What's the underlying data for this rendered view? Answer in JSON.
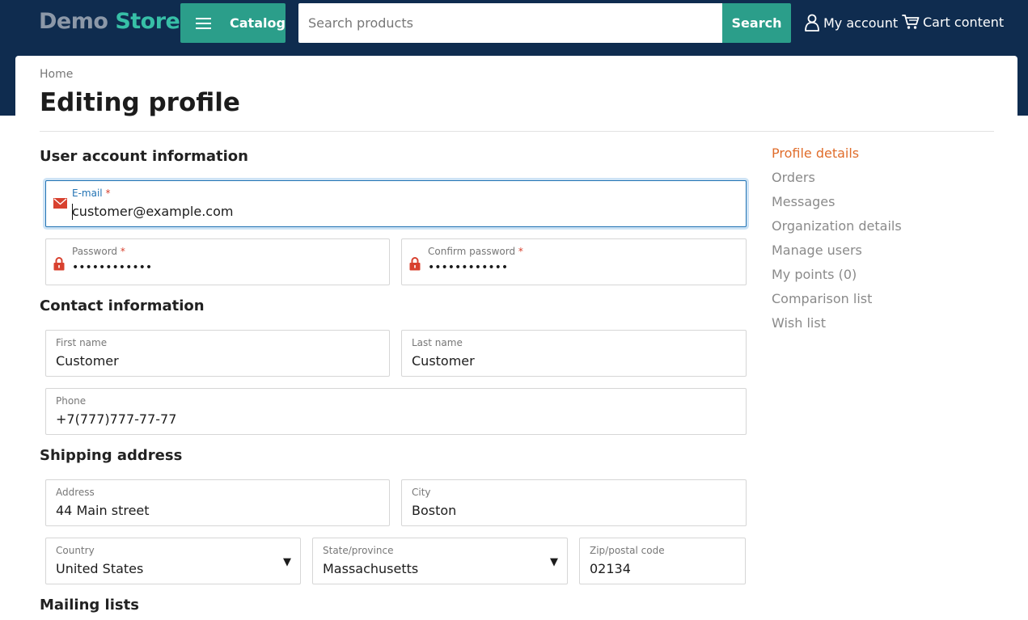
{
  "header": {
    "logo_part1": "Demo",
    "logo_part2": "Store",
    "catalog_label": "Catalog",
    "search_placeholder": "Search products",
    "search_button": "Search",
    "account_label": "My account",
    "cart_label": "Cart content"
  },
  "breadcrumb": "Home",
  "page_title": "Editing profile",
  "sections": {
    "account": "User account information",
    "contact": "Contact information",
    "shipping": "Shipping address",
    "mailing": "Mailing lists"
  },
  "fields": {
    "email": {
      "label": "E-mail",
      "required": "*",
      "value": "customer@example.com"
    },
    "password": {
      "label": "Password",
      "required": "*",
      "value": "••••••••••••"
    },
    "confirm_password": {
      "label": "Confirm password",
      "required": "*",
      "value": "••••••••••••"
    },
    "first_name": {
      "label": "First name",
      "value": "Customer"
    },
    "last_name": {
      "label": "Last name",
      "value": "Customer"
    },
    "phone": {
      "label": "Phone",
      "value": "+7(777)777-77-77"
    },
    "address": {
      "label": "Address",
      "value": "44 Main street"
    },
    "city": {
      "label": "City",
      "value": "Boston"
    },
    "country": {
      "label": "Country",
      "value": "United States",
      "caret": "▼"
    },
    "state": {
      "label": "State/province",
      "value": "Massachusetts",
      "caret": "▼"
    },
    "zip": {
      "label": "Zip/postal code",
      "value": "02134"
    }
  },
  "side_menu": {
    "items": [
      {
        "label": "Profile details",
        "active": true
      },
      {
        "label": "Orders"
      },
      {
        "label": "Messages"
      },
      {
        "label": "Organization details"
      },
      {
        "label": "Manage users"
      },
      {
        "label": "My points (0)"
      },
      {
        "label": "Comparison list"
      },
      {
        "label": "Wish list"
      }
    ]
  },
  "colors": {
    "header_bg": "#0f2c4f",
    "accent": "#2b9e8a",
    "active_menu": "#e06d2b",
    "required_mark": "#d8412f",
    "focus_border": "#2273b4"
  },
  "icons": {
    "catalog": "hamburger-icon",
    "account": "user-icon",
    "cart": "cart-icon",
    "email": "envelope-icon",
    "password": "lock-icon"
  }
}
